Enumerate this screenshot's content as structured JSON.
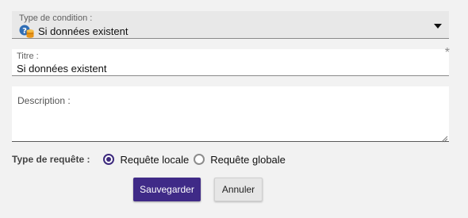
{
  "condition_type": {
    "label": "Type de condition :",
    "value": "Si données existent",
    "icon": "data-exists-icon"
  },
  "title_field": {
    "label": "Titre :",
    "value": "Si données existent",
    "required_mark": "*"
  },
  "description_field": {
    "label": "Description :",
    "value": ""
  },
  "query_type": {
    "label": "Type de requête :",
    "options": [
      {
        "label": "Requête locale",
        "checked": true
      },
      {
        "label": "Requête globale",
        "checked": false
      }
    ],
    "accent_color": "#3d2a7d"
  },
  "actions": {
    "save_label": "Sauvegarder",
    "cancel_label": "Annuler",
    "save_color": "#3f2a87"
  }
}
